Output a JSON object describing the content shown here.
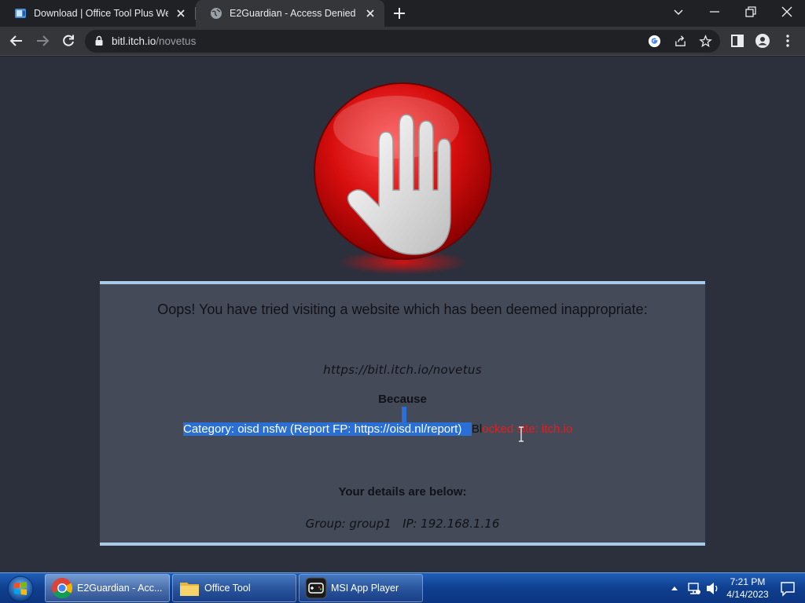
{
  "browser": {
    "tabs": [
      {
        "title": "Download | Office Tool Plus Web",
        "active": false
      },
      {
        "title": "E2Guardian - Access Denied",
        "active": true
      }
    ],
    "address": {
      "host": "bitl.itch.io",
      "path": "/novetus"
    }
  },
  "block_page": {
    "heading": "Oops! You have tried visiting a website which has been deemed inappropriate:",
    "blocked_url": "https://bitl.itch.io/novetus",
    "because_label": "Because",
    "reason_selected": "Category: oisd nsfw (Report FP: https://oisd.nl/report)",
    "reason_sel_tail": "Bl",
    "reason_rest": "ocked site: itch.io",
    "details_label": "Your details are below:",
    "group_ip": "Group: group1   IP: 192.168.1.16"
  },
  "taskbar": {
    "items": [
      {
        "label": "E2Guardian - Acc...",
        "icon": "chrome-icon",
        "active": true
      },
      {
        "label": "Office Tool",
        "icon": "folder-icon",
        "active": false
      },
      {
        "label": "MSI App Player",
        "icon": "app-player-icon",
        "active": false
      }
    ],
    "time": "7:21 PM",
    "date": "4/14/2023"
  },
  "colors": {
    "accent_selection": "#2a6fd6",
    "block_red": "#e41e1e",
    "panel_border": "#a9cbe9"
  }
}
